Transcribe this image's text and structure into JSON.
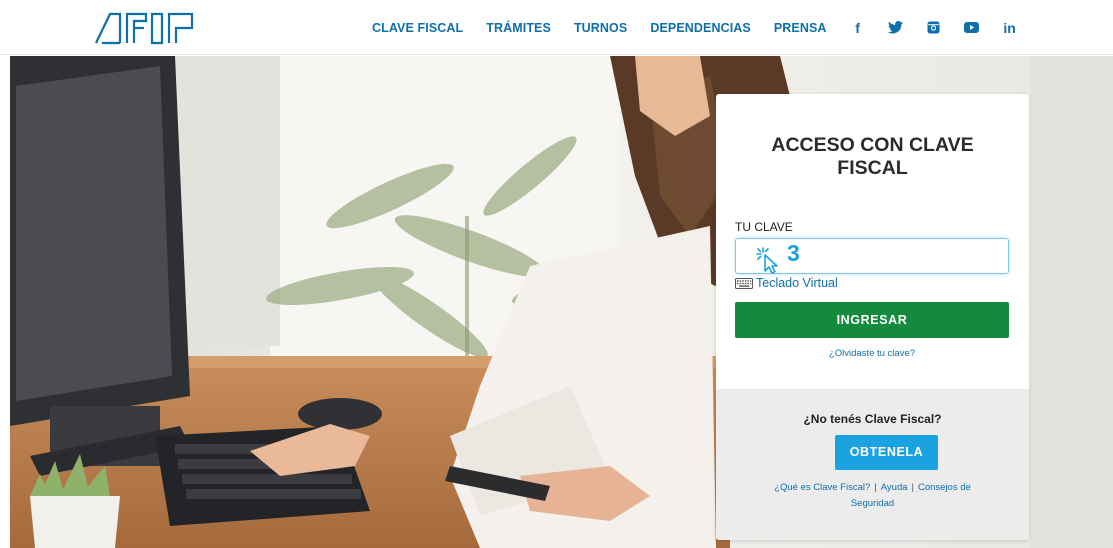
{
  "header": {
    "nav": [
      "CLAVE FISCAL",
      "TRÁMITES",
      "TURNOS",
      "DEPENDENCIAS",
      "PRENSA"
    ],
    "social_icons": [
      "facebook-icon",
      "twitter-icon",
      "instagram-icon",
      "youtube-icon",
      "linkedin-icon"
    ],
    "social_glyphs": {
      "facebook": "f",
      "linkedin": "in"
    }
  },
  "login": {
    "title": "ACCESO CON CLAVE FISCAL",
    "field_label": "TU CLAVE",
    "password_value": "",
    "step_number": "3",
    "virtual_keyboard_label": "Teclado Virtual",
    "submit_label": "INGRESAR",
    "forgot_label": "¿Olvidaste tu clave?"
  },
  "signup": {
    "question": "¿No tenés Clave Fiscal?",
    "button_label": "OBTENELA",
    "link_what": "¿Qué es Clave Fiscal?",
    "link_help": "Ayuda",
    "link_security": "Consejos de Seguridad",
    "separator": "|"
  },
  "colors": {
    "brand_blue": "#0f6fa9",
    "submit_green": "#148a3c",
    "obtain_blue": "#1aa3e0",
    "step_cyan": "#1aa2dd"
  }
}
